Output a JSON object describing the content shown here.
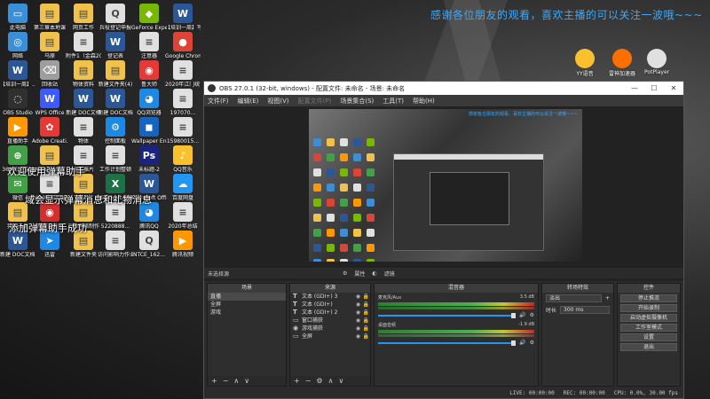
{
  "wallpaper": {
    "banner": "感谢各位朋友的观看，喜欢主播的可以关注一波哦~~~",
    "overlay_lines": [
      "欢迎使用弹幕助手",
      "域会显示弹幕消息和礼物消息",
      "添加弹幕助手成功"
    ]
  },
  "desktop_icons": [
    {
      "label": "此电脑",
      "color": "#3b8ed8",
      "glyph": "▭"
    },
    {
      "label": "第三章本地课",
      "color": "#f1c24b",
      "glyph": "▤"
    },
    {
      "label": "网页工作",
      "color": "#f1c24b",
      "glyph": "▤"
    },
    {
      "label": "兵役登记申报",
      "color": "#e0e0e0",
      "glyph": "Q"
    },
    {
      "label": "GeForce Experience",
      "color": "#76b900",
      "glyph": "◆"
    },
    {
      "label": "【培训一周】写作课程...",
      "color": "#2b5797",
      "glyph": "W"
    },
    {
      "label": "网络",
      "color": "#3b8ed8",
      "glyph": "◎"
    },
    {
      "label": "马原",
      "color": "#f1c24b",
      "glyph": "▤"
    },
    {
      "label": "附件1（金森2021年...",
      "color": "#e0e0e0",
      "glyph": "≡"
    },
    {
      "label": "登记表",
      "color": "#2b5797",
      "glyph": "W"
    },
    {
      "label": "注意器",
      "color": "#e0e0e0",
      "glyph": "≡"
    },
    {
      "label": "Google Chrome",
      "color": "#db4437",
      "glyph": "●"
    },
    {
      "label": "【培训一周】...",
      "color": "#2b5797",
      "glyph": "W"
    },
    {
      "label": "回收站",
      "color": "#9e9e9e",
      "glyph": "⌫"
    },
    {
      "label": "物体资料",
      "color": "#f1c24b",
      "glyph": "▤"
    },
    {
      "label": "新建文件夹(4)",
      "color": "#f1c24b",
      "glyph": "▤"
    },
    {
      "label": "鲁大师",
      "color": "#e53935",
      "glyph": "◉"
    },
    {
      "label": "2020年江门统计局...",
      "color": "#e0e0e0",
      "glyph": "≡"
    },
    {
      "label": "OBS Studio",
      "color": "#303030",
      "glyph": "◌"
    },
    {
      "label": "WPS Office",
      "color": "#3d5afe",
      "glyph": "W"
    },
    {
      "label": "新建 DOC文档",
      "color": "#2b5797",
      "glyph": "W"
    },
    {
      "label": "新建 DOC文档",
      "color": "#2b5797",
      "glyph": "W"
    },
    {
      "label": "QQ浏览器",
      "color": "#1e88e5",
      "glyph": "◕"
    },
    {
      "label": "197070...",
      "color": "#e0e0e0",
      "glyph": "≡"
    },
    {
      "label": "直播助手",
      "color": "#ff9800",
      "glyph": "▶"
    },
    {
      "label": "Adobe Creati...",
      "color": "#e53935",
      "glyph": "✿"
    },
    {
      "label": "物体",
      "color": "#e0e0e0",
      "glyph": "≡"
    },
    {
      "label": "控制面板",
      "color": "#1e88e5",
      "glyph": "⚙"
    },
    {
      "label": "Wallpaper Engine",
      "color": "#1565c0",
      "glyph": "◼"
    },
    {
      "label": "15980015...",
      "color": "#e0e0e0",
      "glyph": "≡"
    },
    {
      "label": "360安全卫士",
      "color": "#43a047",
      "glyph": "⊕"
    },
    {
      "label": "Administr...",
      "color": "#f1c24b",
      "glyph": "▤"
    },
    {
      "label": "张玉振片",
      "color": "#e0e0e0",
      "glyph": "≡"
    },
    {
      "label": "工作计划整顿",
      "color": "#e0e0e0",
      "glyph": "≡"
    },
    {
      "label": "未标题-2",
      "color": "#1a237e",
      "glyph": "Ps"
    },
    {
      "label": "QQ音乐",
      "color": "#fbc02d",
      "glyph": "♪"
    },
    {
      "label": "微信",
      "color": "#43a047",
      "glyph": "✉"
    },
    {
      "label": "2020年江门统计局...",
      "color": "#e0e0e0",
      "glyph": "≡"
    },
    {
      "label": "图片",
      "color": "#f1c24b",
      "glyph": "▤"
    },
    {
      "label": "Microsoft Office Ex...",
      "color": "#1e7145",
      "glyph": "X"
    },
    {
      "label": "Microsoft Office Wo...",
      "color": "#2b5797",
      "glyph": "W"
    },
    {
      "label": "百度网盘",
      "color": "#2196f3",
      "glyph": "☁"
    },
    {
      "label": "我的云盘",
      "color": "#f1c24b",
      "glyph": "▤"
    },
    {
      "label": "网易云音乐",
      "color": "#d32f2f",
      "glyph": "◉"
    },
    {
      "label": "二级网络制作",
      "color": "#f1c24b",
      "glyph": "▤"
    },
    {
      "label": "5220888...",
      "color": "#e0e0e0",
      "glyph": "≡"
    },
    {
      "label": "腾讯QQ",
      "color": "#1e88e5",
      "glyph": "◕"
    },
    {
      "label": "2020年总结",
      "color": "#e0e0e0",
      "glyph": "≡"
    },
    {
      "label": "新建 DOC文档 (3)",
      "color": "#2b5797",
      "glyph": "W"
    },
    {
      "label": "迅雷",
      "color": "#1e88e5",
      "glyph": "➤"
    },
    {
      "label": "新建文件夹",
      "color": "#f1c24b",
      "glyph": "▤"
    },
    {
      "label": "访问影响力作业",
      "color": "#e0e0e0",
      "glyph": "≡"
    },
    {
      "label": "NTCE_162...",
      "color": "#e0e0e0",
      "glyph": "Q"
    },
    {
      "label": "腾讯视频",
      "color": "#ff9800",
      "glyph": "▶"
    }
  ],
  "tray_icons": [
    {
      "label": "YY语音",
      "color": "#fbc02d"
    },
    {
      "label": "雷神加速器",
      "color": "#ff6f00"
    },
    {
      "label": "PotPlayer",
      "color": "#e0e0e0"
    }
  ],
  "obs": {
    "title": "OBS 27.0.1 (32-bit, windows) - 配置文件: 未命名 - 场景: 未命名",
    "menu": [
      "文件(F)",
      "编辑(E)",
      "视图(V)",
      "配置文件(P)",
      "场景集合(S)",
      "工具(T)",
      "帮助(H)"
    ],
    "menu_dim": [
      false,
      false,
      false,
      true,
      false,
      false,
      false
    ],
    "preview_caption": "感谢各位朋友的观看，喜欢主播的可以关注一波哦~~~",
    "source_toolbar": {
      "label": "未选择源",
      "properties": "属性",
      "filters": "滤镜"
    },
    "scenes": {
      "title": "场景",
      "items": [
        "直播",
        "全屏",
        "游戏"
      ],
      "selected": 0
    },
    "sources": {
      "title": "来源",
      "items": [
        {
          "type": "T",
          "name": "文本 (GDI+) 3"
        },
        {
          "type": "T",
          "name": "文本 (GDI+)"
        },
        {
          "type": "T",
          "name": "文本 (GDI+) 2"
        },
        {
          "type": "▭",
          "name": "窗口捕获"
        },
        {
          "type": "◉",
          "name": "游戏捕获"
        },
        {
          "type": "▭",
          "name": "全屏"
        }
      ]
    },
    "mixer": {
      "title": "混音器",
      "channels": [
        {
          "name": "麦克风/Aux",
          "db": "3.5 dB",
          "level": 0.92
        },
        {
          "name": "桌面音频",
          "db": "-1.9 dB",
          "level": 0.88
        }
      ]
    },
    "transitions": {
      "title": "转场特效",
      "type": "淡出",
      "duration_label": "时长",
      "duration": "300 ms"
    },
    "controls": {
      "title": "控件",
      "buttons": [
        "停止推流",
        "开始录制",
        "启动虚拟摄像机",
        "工作室模式",
        "设置",
        "退出"
      ]
    },
    "status": {
      "live": "LIVE: 00:00:00",
      "rec": "REC: 00:00:00",
      "cpu": "CPU: 0.0%, 30.00 fps"
    }
  }
}
